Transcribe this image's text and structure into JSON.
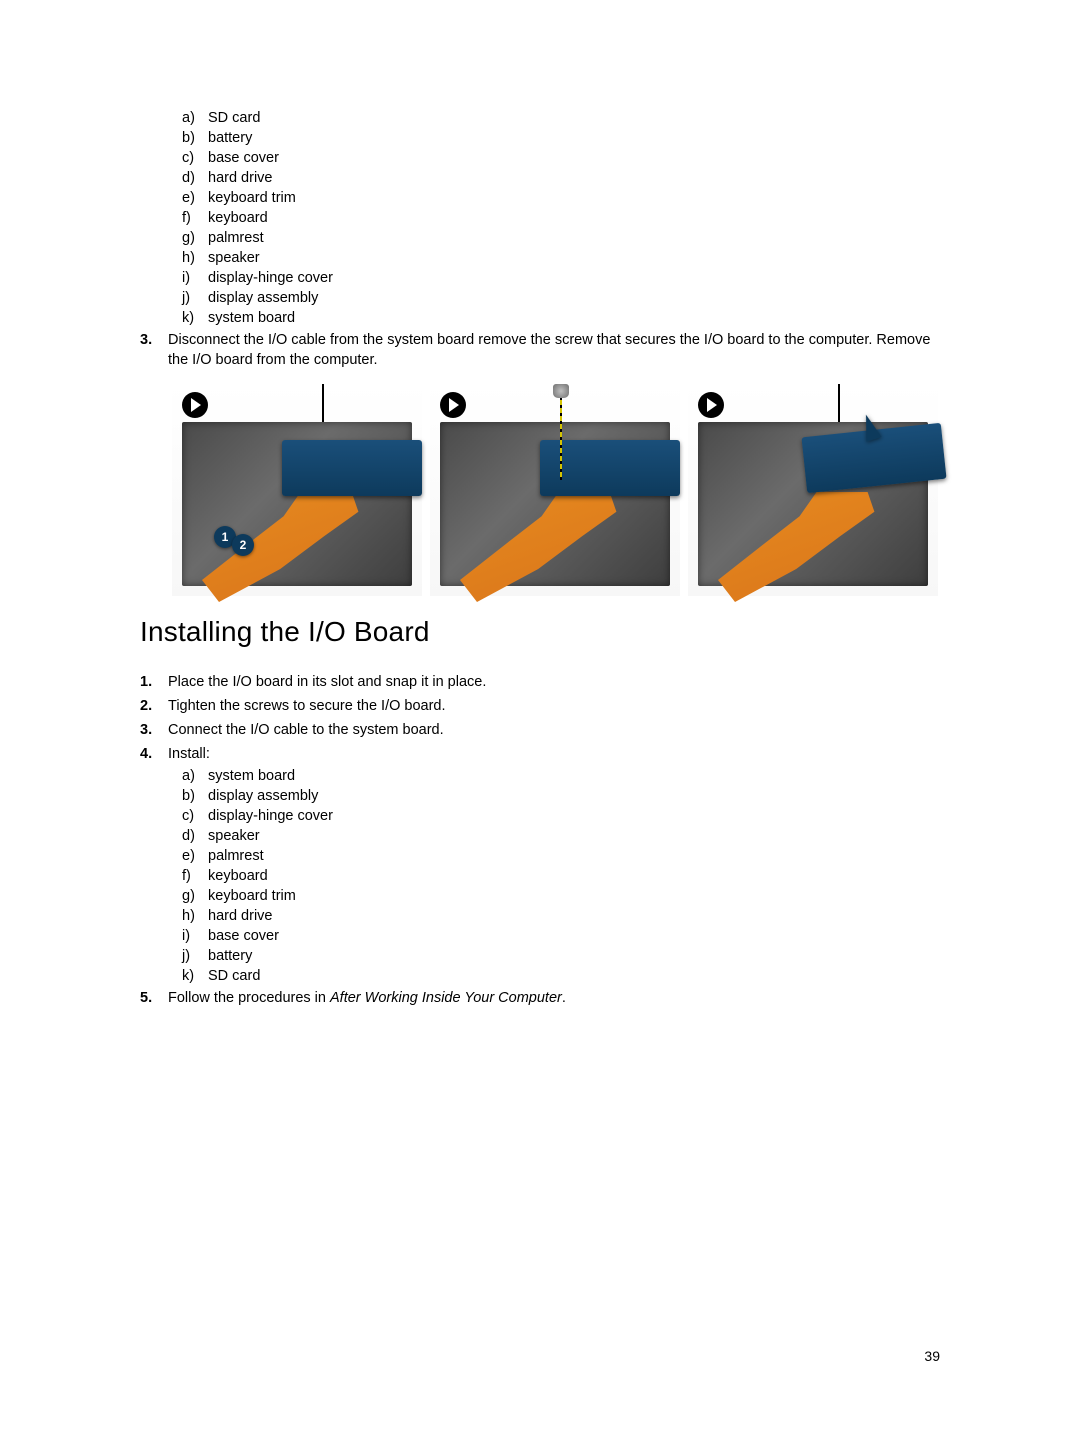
{
  "page_number": "39",
  "section_heading": "Installing the I/O Board",
  "top_sublist": [
    "SD card",
    "battery",
    "base cover",
    "hard drive",
    "keyboard trim",
    "keyboard",
    "palmrest",
    "speaker",
    "display-hinge cover",
    "display assembly",
    "system board"
  ],
  "step3": {
    "number": "3.",
    "text": "Disconnect the I/O cable from the system board remove the screw that secures the I/O board to the computer. Remove the I/O board from the computer."
  },
  "figure_callouts": {
    "m1": "1",
    "m2": "2"
  },
  "install_steps": {
    "s1": {
      "n": "1.",
      "t": "Place the I/O board in its slot and snap it in place."
    },
    "s2": {
      "n": "2.",
      "t": "Tighten the screws to secure the I/O board."
    },
    "s3": {
      "n": "3.",
      "t": "Connect the I/O cable to the system board."
    },
    "s4": {
      "n": "4.",
      "t": "Install:"
    },
    "s5": {
      "n": "5.",
      "t_pre": "Follow the procedures in ",
      "t_italic": "After Working Inside Your Computer",
      "t_post": "."
    }
  },
  "install_sublist": [
    "system board",
    "display assembly",
    "display-hinge cover",
    "speaker",
    "palmrest",
    "keyboard",
    "keyboard trim",
    "hard drive",
    "base cover",
    "battery",
    "SD card"
  ],
  "letter_markers": [
    "a)",
    "b)",
    "c)",
    "d)",
    "e)",
    "f)",
    "g)",
    "h)",
    "i)",
    "j)",
    "k)"
  ]
}
